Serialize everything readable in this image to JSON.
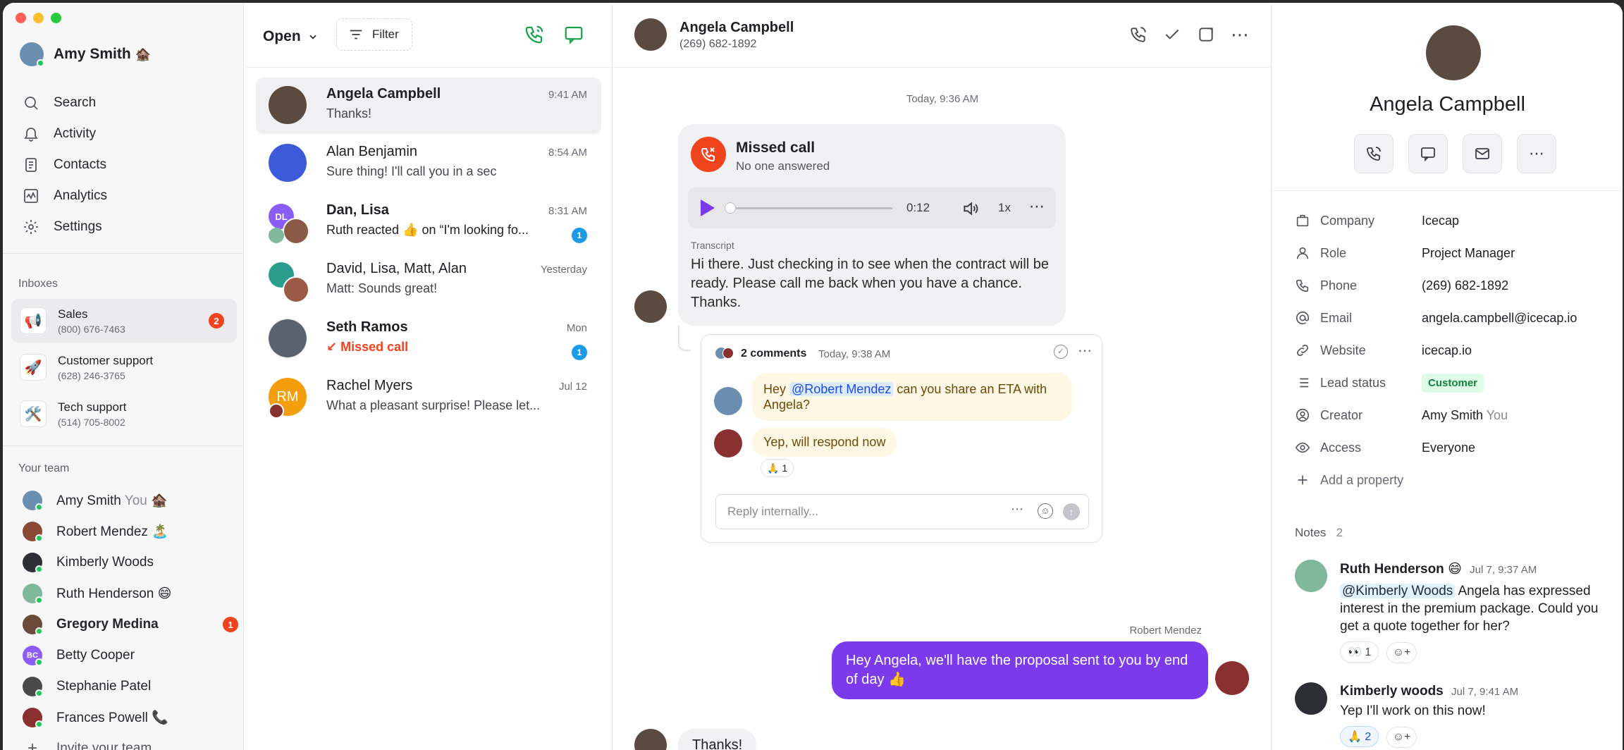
{
  "user": {
    "name": "Amy Smith",
    "status_emoji": "🏚️"
  },
  "nav": [
    "Search",
    "Activity",
    "Contacts",
    "Analytics",
    "Settings"
  ],
  "inboxes_label": "Inboxes",
  "inboxes": [
    {
      "name": "Sales",
      "number": "(800) 676-7463",
      "icon": "📢",
      "badge": "2"
    },
    {
      "name": "Customer support",
      "number": "(628) 246-3765",
      "icon": "🚀",
      "badge": ""
    },
    {
      "name": "Tech support",
      "number": "(514) 705-8002",
      "icon": "🛠️",
      "badge": ""
    }
  ],
  "team_label": "Your team",
  "team": [
    {
      "name": "Amy Smith",
      "suffix": "You",
      "emoji": "🏚️",
      "badge": "",
      "color": "#6b8fb0"
    },
    {
      "name": "Robert Mendez",
      "suffix": "",
      "emoji": "🏝️",
      "badge": "",
      "color": "#8a4a36"
    },
    {
      "name": "Kimberly Woods",
      "suffix": "",
      "emoji": "",
      "badge": "",
      "color": "#2e2e36"
    },
    {
      "name": "Ruth Henderson",
      "suffix": "",
      "emoji": "😄",
      "badge": "",
      "color": "#7fb89a"
    },
    {
      "name": "Gregory Medina",
      "suffix": "",
      "emoji": "",
      "badge": "1",
      "color": "#6b4a3a"
    },
    {
      "name": "Betty Cooper",
      "suffix": "",
      "emoji": "",
      "badge": "",
      "color": "#8b5cf6",
      "initials": "BC"
    },
    {
      "name": "Stephanie Patel",
      "suffix": "",
      "emoji": "",
      "badge": "",
      "color": "#4a4a4a"
    },
    {
      "name": "Frances Powell",
      "suffix": "",
      "emoji": "📞",
      "badge": "",
      "color": "#8a3030"
    }
  ],
  "invite": "Invite your team",
  "list": {
    "filter_state": "Open",
    "filter_label": "Filter",
    "conversations": [
      {
        "name": "Angela Campbell",
        "preview": "Thanks!",
        "time": "9:41 AM",
        "badge": "",
        "color": "#5a4a40"
      },
      {
        "name": "Alan Benjamin",
        "preview": "Sure thing! I'll call you in a sec",
        "time": "8:54 AM",
        "badge": "",
        "color": "#3b5bdb"
      },
      {
        "name": "Dan, Lisa",
        "preview": "Ruth reacted 👍 on “I'm looking fo...",
        "time": "8:31 AM",
        "badge": "1",
        "color": "#8b5cf6",
        "initials": "DL"
      },
      {
        "name": "David, Lisa, Matt, Alan",
        "preview": "Matt: Sounds great!",
        "time": "Yesterday",
        "badge": "",
        "color": "#7a6a5a"
      },
      {
        "name": "Seth Ramos",
        "preview": "Missed call",
        "time": "Mon",
        "badge": "1",
        "color": "#5a6470"
      },
      {
        "name": "Rachel Myers",
        "preview": "What a pleasant surprise! Please let...",
        "time": "Jul 12",
        "badge": "",
        "color": "#f59e0b",
        "initials": "RM"
      }
    ]
  },
  "chat": {
    "contact_name": "Angela Campbell",
    "contact_phone": "(269) 682-1892",
    "day_label": "Today, 9:36 AM",
    "missed_title": "Missed call",
    "missed_sub": "No one answered",
    "audio_time": "0:12",
    "audio_speed": "1x",
    "transcript_label": "Transcript",
    "transcript": "Hi there. Just checking in to see when the contract will be ready. Please call me back when you have a chance. Thanks.",
    "thread_count": "2 comments",
    "thread_time": "Today, 9:38 AM",
    "comment1_pre": "Hey ",
    "comment1_mention": "@Robert Mendez",
    "comment1_post": " can you share an ETA with Angela?",
    "comment2": "Yep, will respond now",
    "comment2_reaction": "🙏 1",
    "reply_placeholder": "Reply internally...",
    "out_sender": "Robert Mendez",
    "out_message": "Hey Angela, we'll have the proposal sent to you by end of day 👍",
    "last_message": "Thanks!"
  },
  "details": {
    "name": "Angela Campbell",
    "props": [
      {
        "key": "Company",
        "value": "Icecap"
      },
      {
        "key": "Role",
        "value": "Project Manager"
      },
      {
        "key": "Phone",
        "value": "(269) 682-1892"
      },
      {
        "key": "Email",
        "value": "angela.campbell@icecap.io"
      },
      {
        "key": "Website",
        "value": "icecap.io"
      },
      {
        "key": "Lead status",
        "value": "Customer"
      },
      {
        "key": "Creator",
        "value": "Amy Smith",
        "suffix": "You"
      },
      {
        "key": "Access",
        "value": "Everyone"
      }
    ],
    "add_property": "Add a property",
    "notes_label": "Notes",
    "notes_count": "2",
    "notes": [
      {
        "author": "Ruth Henderson",
        "emoji": "😄",
        "time": "Jul 7, 9:37 AM",
        "mention": "@Kimberly Woods",
        "text": " Angela has expressed interest in the premium package. Could you get a quote together for her?",
        "reaction": "👀 1"
      },
      {
        "author": "Kimberly woods",
        "emoji": "",
        "time": "Jul 7, 9:41 AM",
        "mention": "",
        "text": "Yep I'll work on this now!",
        "reaction": "🙏 2"
      }
    ]
  },
  "colors": {
    "accent": "#7c3aed",
    "missed": "#f0441f",
    "green": "#16a34a",
    "blue": "#1c9be9"
  }
}
